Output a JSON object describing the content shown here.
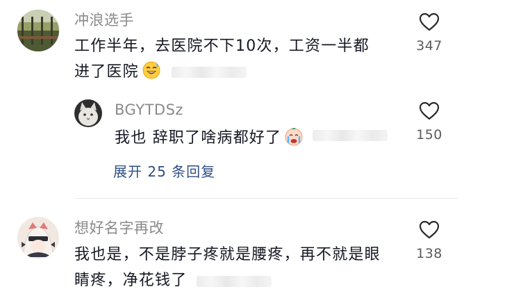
{
  "comments": [
    {
      "username": "冲浪选手",
      "text_line1": "工作半年，去医院不下10次，工资一半都",
      "text_line2": "进了医院",
      "like_count": "347",
      "avatar_icon": "landscape-avatar-icon",
      "emoji": "sweat-smile-emoji",
      "reply": {
        "username": "BGYTDSz",
        "text": "我也 辞职了啥病都好了",
        "like_count": "150",
        "avatar_icon": "cat-avatar-icon",
        "emoji": "crying-face-emoji"
      },
      "expand_label": "展开 25 条回复"
    },
    {
      "username": "想好名字再改",
      "text_line1": "我也是，不是脖子疼就是腰疼，再不就是眼",
      "text_line2": "睛疼，净花钱了",
      "like_count": "138",
      "avatar_icon": "girl-avatar-icon"
    }
  ],
  "icons": {
    "like": "heart-outline-icon"
  },
  "colors": {
    "username": "#8a8a8a",
    "text": "#161823",
    "expand_link": "#2f4e84",
    "count": "#5b5b5b"
  }
}
